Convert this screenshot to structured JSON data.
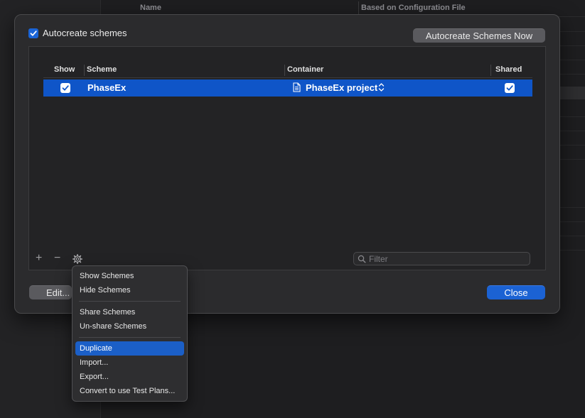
{
  "background": {
    "columns": {
      "name": "Name",
      "based_on": "Based on Configuration File"
    }
  },
  "sheet": {
    "autocreate_label": "Autocreate schemes",
    "autocreate_checked": true,
    "autocreate_now_button": "Autocreate Schemes Now",
    "edit_button": "Edit...",
    "close_button": "Close"
  },
  "table": {
    "headers": {
      "show": "Show",
      "scheme": "Scheme",
      "container": "Container",
      "shared": "Shared"
    },
    "rows": [
      {
        "show": true,
        "scheme": "PhaseEx",
        "container": "PhaseEx project",
        "shared": true,
        "selected": true
      }
    ]
  },
  "toolbar": {
    "add_symbol": "+",
    "remove_symbol": "−",
    "filter_placeholder": "Filter"
  },
  "menu": {
    "items": [
      {
        "label": "Show Schemes"
      },
      {
        "label": "Hide Schemes"
      },
      {
        "label": "Share Schemes"
      },
      {
        "label": "Un-share Schemes"
      },
      {
        "label": "Duplicate",
        "highlighted": true
      },
      {
        "label": "Import..."
      },
      {
        "label": "Export..."
      },
      {
        "label": "Convert to use Test Plans..."
      }
    ]
  },
  "colors": {
    "accent": "#1b62d3",
    "selection": "#0f55c8",
    "sheet_bg": "#2b2b2d"
  },
  "icons": [
    "checkbox-checked-icon",
    "document-icon",
    "updown-chevron-icon",
    "gear-icon",
    "search-icon"
  ]
}
